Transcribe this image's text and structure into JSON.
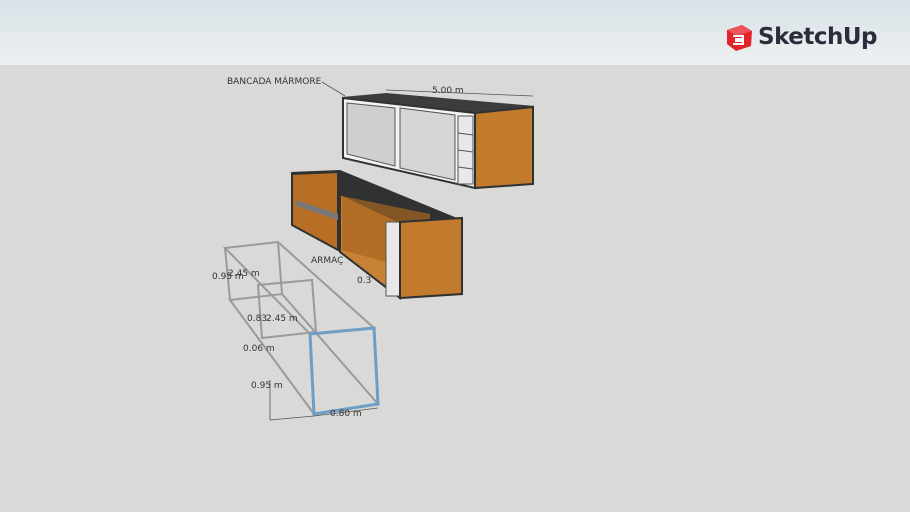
{
  "brand": {
    "name": "SketchUp",
    "logo_color": "#e2252b"
  },
  "colors": {
    "wood": "#c27a2c",
    "frame": "#2f3133",
    "glass": "#d6d6d6",
    "highlight": "#6f9ec4"
  },
  "labels": {
    "marble_top": "BANCADA MÁRMORE",
    "length": "5.00 m",
    "frame": "ARMAÇ",
    "depth_partial": "0.3",
    "dim_095_top": "0.95 m",
    "dim_245_top": "2.45 m",
    "dim_083": "0.83",
    "dim_245_mid": "2.45 m",
    "dim_006": "0.06 m",
    "dim_095_bottom": "0.95 m",
    "dim_080": "0.80 m"
  }
}
